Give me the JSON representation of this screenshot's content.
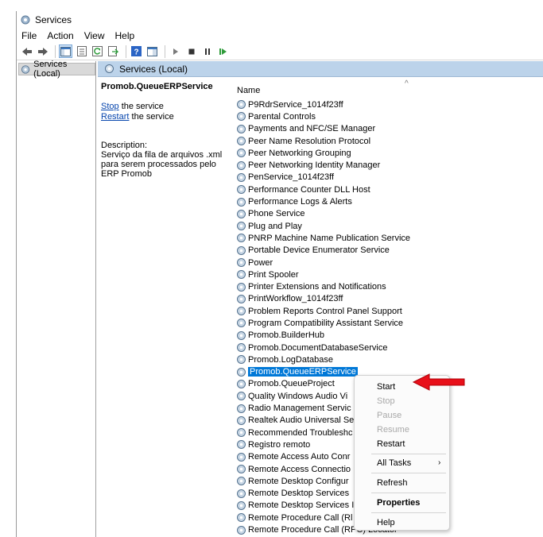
{
  "window": {
    "title": "Services"
  },
  "menu": [
    "File",
    "Action",
    "View",
    "Help"
  ],
  "tree": {
    "root_label": "Services (Local)"
  },
  "content_header": {
    "label": "Services (Local)"
  },
  "details": {
    "service_name": "Promob.QueueERPService",
    "stop_link": "Stop",
    "stop_rest": " the service",
    "restart_link": "Restart",
    "restart_rest": " the service",
    "description_label": "Description:",
    "description_text": "Serviço da fila de arquivos .xml para serem processados pelo ERP Promob"
  },
  "list": {
    "column_name": "Name",
    "sort_glyph": "^",
    "rows": [
      "P9RdrService_1014f23ff",
      "Parental Controls",
      "Payments and NFC/SE Manager",
      "Peer Name Resolution Protocol",
      "Peer Networking Grouping",
      "Peer Networking Identity Manager",
      "PenService_1014f23ff",
      "Performance Counter DLL Host",
      "Performance Logs & Alerts",
      "Phone Service",
      "Plug and Play",
      "PNRP Machine Name Publication Service",
      "Portable Device Enumerator Service",
      "Power",
      "Print Spooler",
      "Printer Extensions and Notifications",
      "PrintWorkflow_1014f23ff",
      "Problem Reports Control Panel Support",
      "Program Compatibility Assistant Service",
      "Promob.BuilderHub",
      "Promob.DocumentDatabaseService",
      "Promob.LogDatabase",
      "Promob.QueueERPService",
      "Promob.QueueProject",
      "Quality Windows Audio Vi",
      "Radio Management Servic",
      "Realtek Audio Universal Se",
      "Recommended Troubleshc",
      "Registro remoto",
      "Remote Access Auto Conr",
      "Remote Access Connectio",
      "Remote Desktop Configur",
      "Remote Desktop Services",
      "Remote Desktop Services I",
      "Remote Procedure Call (Rl",
      "Remote Procedure Call (RPC) Locator"
    ],
    "selected_index": 22
  },
  "context_menu": {
    "start": "Start",
    "stop": "Stop",
    "pause": "Pause",
    "resume": "Resume",
    "restart": "Restart",
    "all_tasks": "All Tasks",
    "all_tasks_arrow": "›",
    "refresh": "Refresh",
    "properties": "Properties",
    "help": "Help"
  },
  "colors": {
    "selection": "#0078d7",
    "header_band": "#bcd3ea",
    "annotation": "#e8101a"
  },
  "icons": [
    "services-app-icon",
    "back-icon",
    "forward-icon",
    "console-tree-icon",
    "properties-icon",
    "refresh-icon",
    "export-icon",
    "help-icon",
    "show-hide-icon",
    "play-icon",
    "stop-icon",
    "pause-icon",
    "resume-icon",
    "gear-icon"
  ]
}
